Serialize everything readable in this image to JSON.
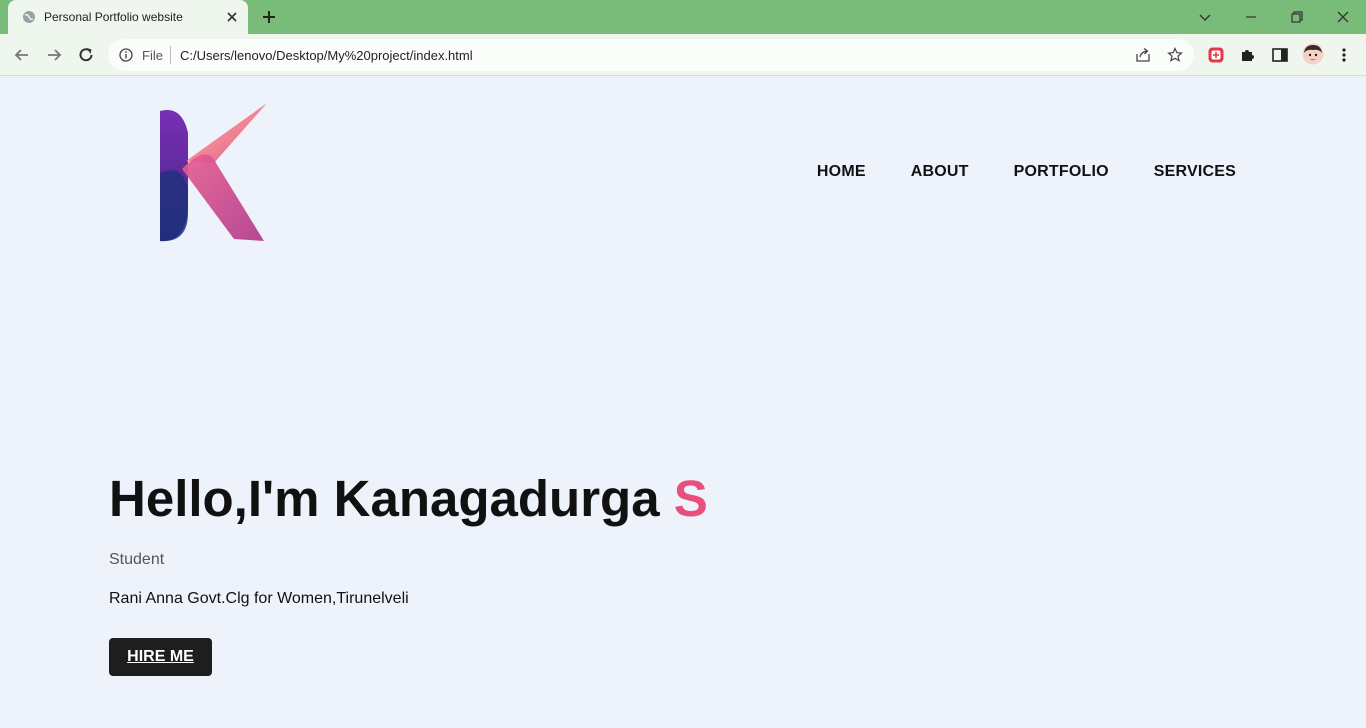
{
  "browser": {
    "tab_title": "Personal Portfolio website",
    "scheme_label": "File",
    "url": "C:/Users/lenovo/Desktop/My%20project/index.html"
  },
  "nav": {
    "items": [
      "HOME",
      "ABOUT",
      "PORTFOLIO",
      "SERVICES"
    ]
  },
  "hero": {
    "greeting": "Hello,I'm Kanagadurga",
    "initial": "S",
    "role": "Student",
    "college": "Rani Anna Govt.Clg for Women,Tirunelveli",
    "hire_label": "HIRE ME"
  },
  "colors": {
    "accent": "#e84f7d",
    "button_bg": "#1e1e1e",
    "page_bg": "#eef3fb",
    "titlebar": "#79bb79"
  },
  "icons": {
    "logo": "K-monogram-logo"
  }
}
